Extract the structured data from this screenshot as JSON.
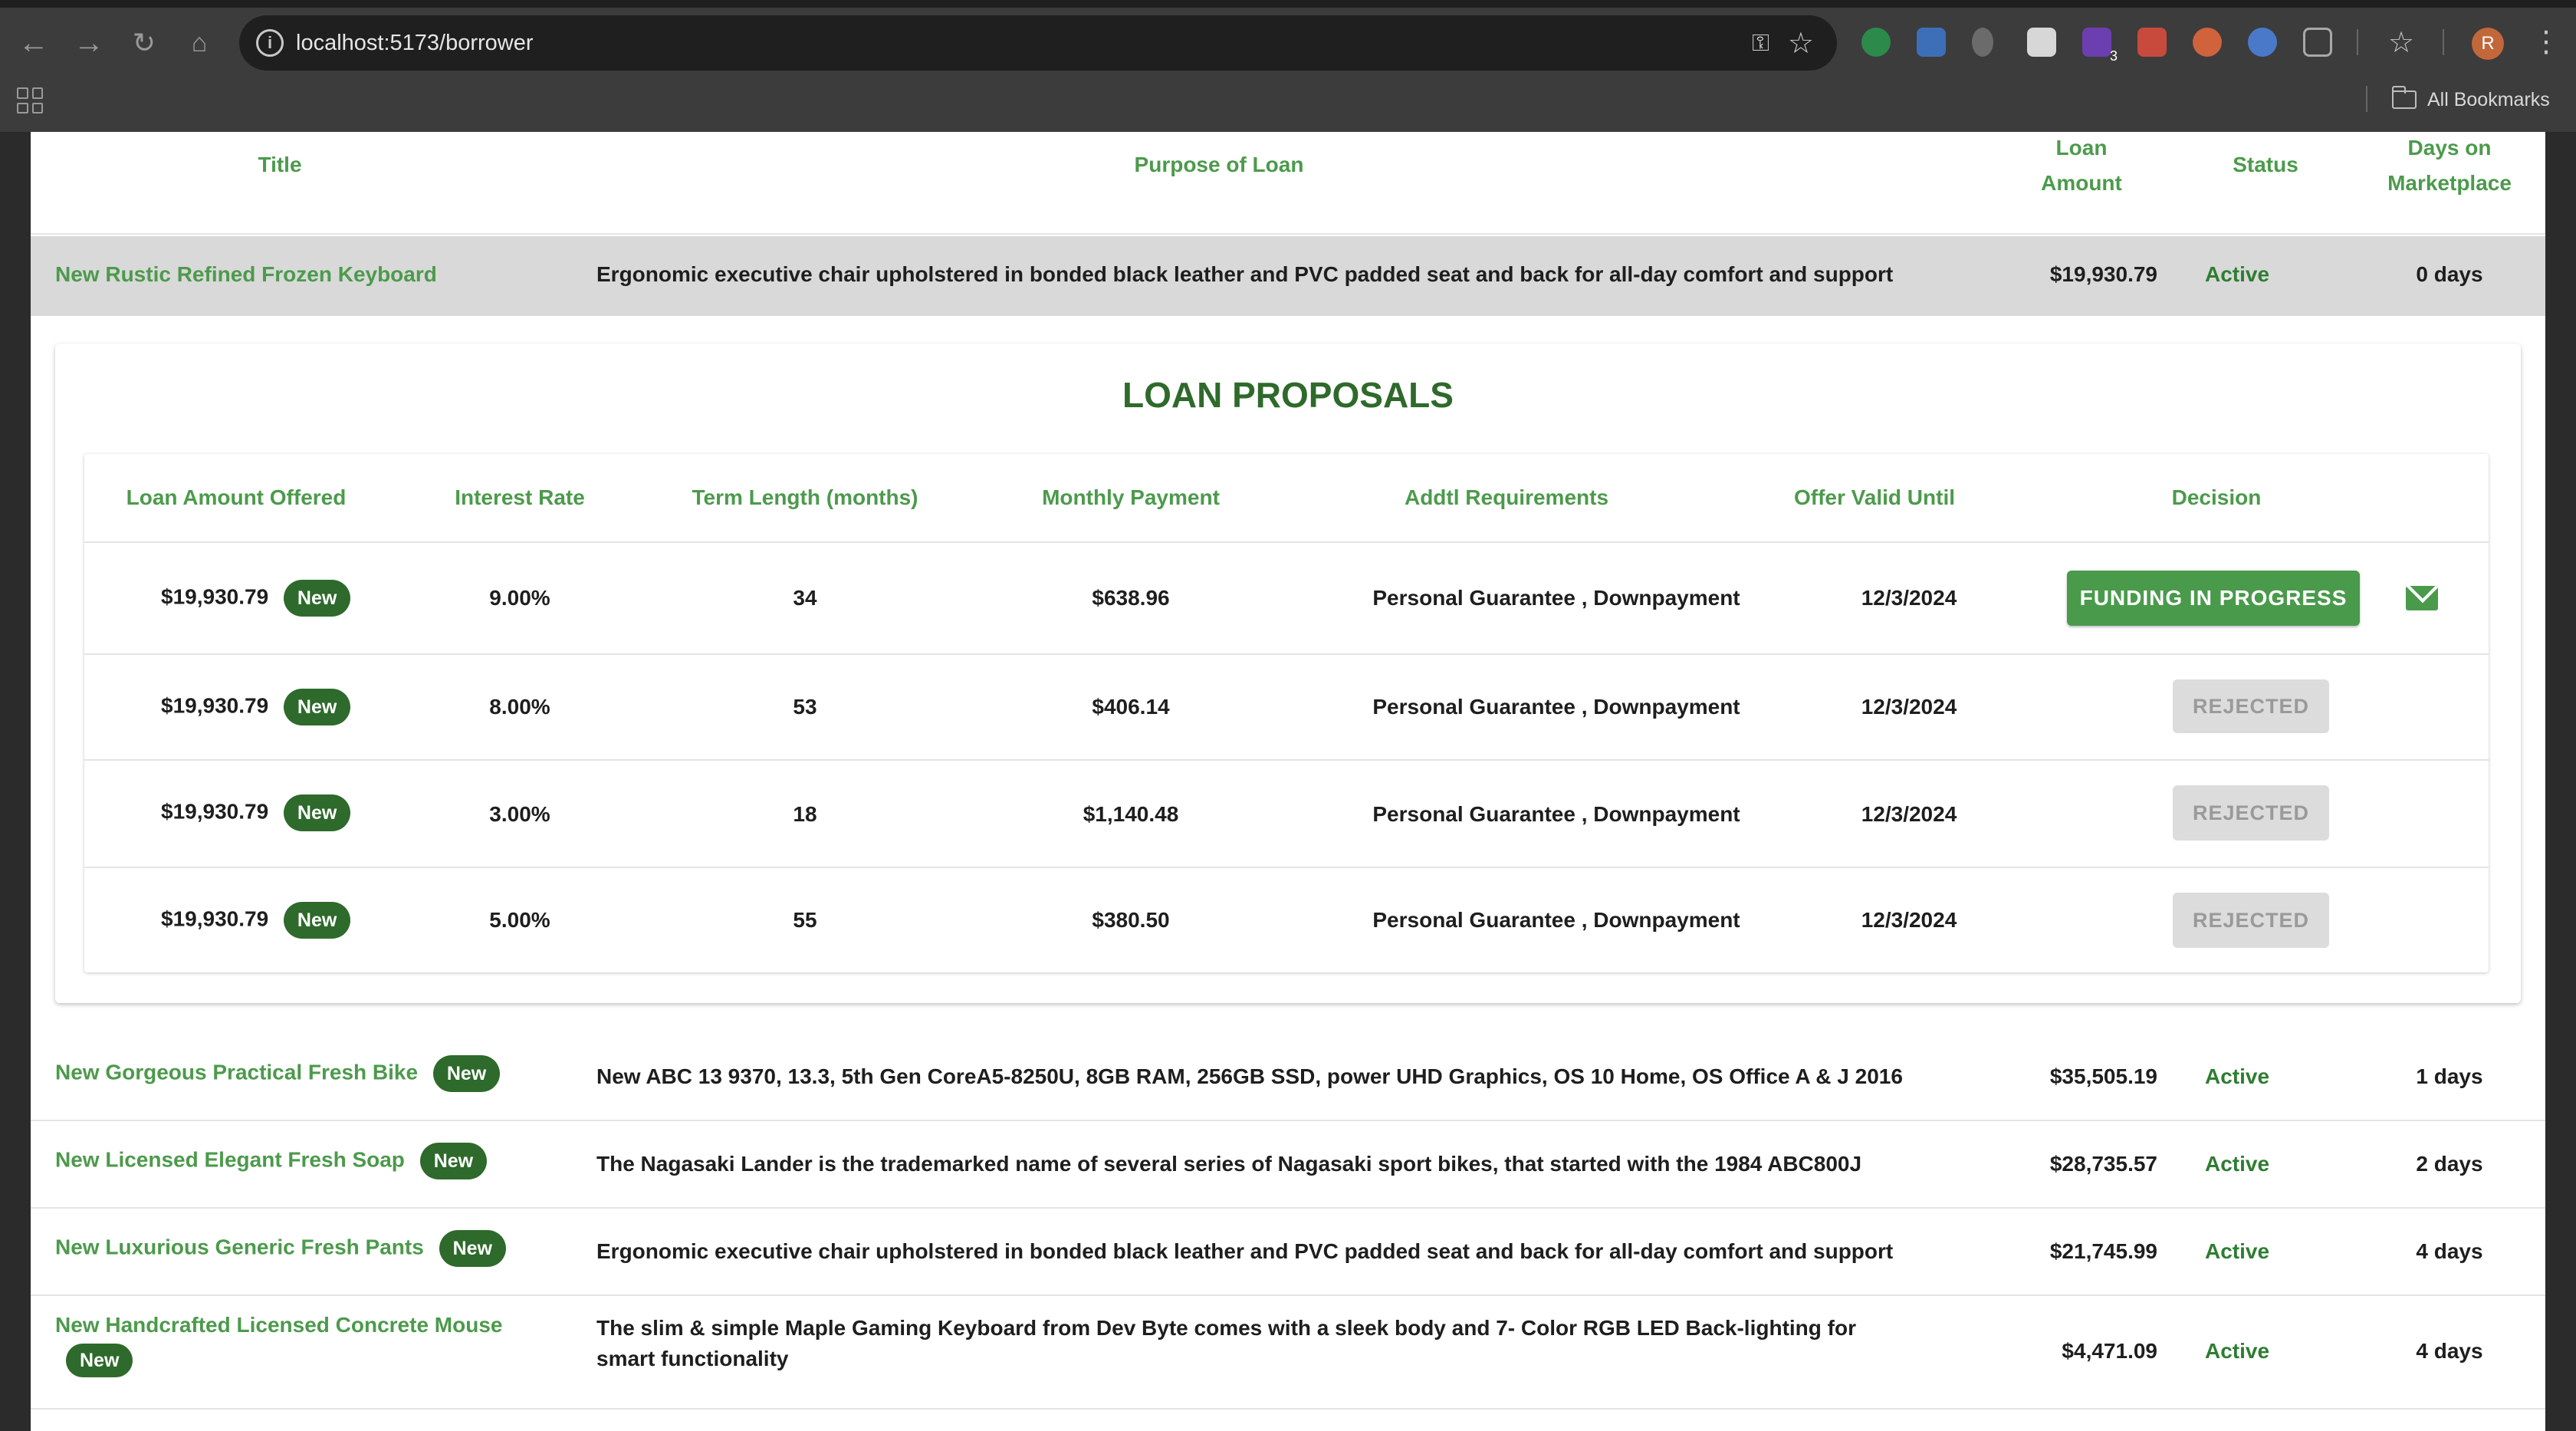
{
  "browser": {
    "url": "localhost:5173/borrower",
    "bookmarks_label": "All Bookmarks",
    "profile_initial": "R",
    "extension_badge": "3"
  },
  "loans_table": {
    "headers": {
      "title": "Title",
      "purpose": "Purpose of Loan",
      "amount_line1": "Loan",
      "amount_line2": "Amount",
      "status": "Status",
      "days_line1": "Days on",
      "days_line2": "Marketplace"
    },
    "expanded_row": {
      "title": "New Rustic Refined Frozen Keyboard",
      "purpose": "Ergonomic executive chair upholstered in bonded black leather and PVC padded seat and back for all-day comfort and support",
      "amount": "$19,930.79",
      "status": "Active",
      "days": "0 days"
    },
    "rows": [
      {
        "title": "New Gorgeous Practical Fresh Bike",
        "badge": "New",
        "purpose": "New ABC 13 9370, 13.3, 5th Gen CoreA5-8250U, 8GB RAM, 256GB SSD, power UHD Graphics, OS 10 Home, OS Office A & J 2016",
        "amount": "$35,505.19",
        "status": "Active",
        "days": "1 days"
      },
      {
        "title": "New Licensed Elegant Fresh Soap",
        "badge": "New",
        "purpose": "The Nagasaki Lander is the trademarked name of several series of Nagasaki sport bikes, that started with the 1984 ABC800J",
        "amount": "$28,735.57",
        "status": "Active",
        "days": "2 days"
      },
      {
        "title": "New Luxurious Generic Fresh Pants",
        "badge": "New",
        "purpose": "Ergonomic executive chair upholstered in bonded black leather and PVC padded seat and back for all-day comfort and support",
        "amount": "$21,745.99",
        "status": "Active",
        "days": "4 days"
      },
      {
        "title": "New Handcrafted Licensed Concrete Mouse",
        "badge": "New",
        "purpose": "The slim & simple Maple Gaming Keyboard from Dev Byte comes with a sleek body and 7- Color RGB LED Back-lighting for smart functionality",
        "amount": "$4,471.09",
        "status": "Active",
        "days": "4 days"
      }
    ]
  },
  "proposals": {
    "title": "LOAN PROPOSALS",
    "headers": {
      "amount": "Loan Amount Offered",
      "rate": "Interest Rate",
      "term": "Term Length (months)",
      "payment": "Monthly Payment",
      "requirements": "Addtl Requirements",
      "valid": "Offer Valid Until",
      "decision": "Decision"
    },
    "rows": [
      {
        "amount": "$19,930.79",
        "badge": "New",
        "rate": "9.00%",
        "term": "34",
        "payment": "$638.96",
        "requirements": "Personal Guarantee , Downpayment",
        "valid": "12/3/2024",
        "decision": "FUNDING IN PROGRESS"
      },
      {
        "amount": "$19,930.79",
        "badge": "New",
        "rate": "8.00%",
        "term": "53",
        "payment": "$406.14",
        "requirements": "Personal Guarantee , Downpayment",
        "valid": "12/3/2024",
        "decision": "REJECTED"
      },
      {
        "amount": "$19,930.79",
        "badge": "New",
        "rate": "3.00%",
        "term": "18",
        "payment": "$1,140.48",
        "requirements": "Personal Guarantee , Downpayment",
        "valid": "12/3/2024",
        "decision": "REJECTED"
      },
      {
        "amount": "$19,930.79",
        "badge": "New",
        "rate": "5.00%",
        "term": "55",
        "payment": "$380.50",
        "requirements": "Personal Guarantee , Downpayment",
        "valid": "12/3/2024",
        "decision": "REJECTED"
      }
    ]
  },
  "colors": {
    "accent_green": "#4c9a4c",
    "dark_green": "#2e6a2b",
    "status_green": "#2e7d32",
    "expanded_row_bg": "#d9d9d9",
    "rejected_bg": "#dcdcdc"
  },
  "icons": {
    "back": "arrow-left-icon",
    "forward": "arrow-right-icon",
    "reload": "reload-icon",
    "home": "home-icon",
    "site_info": "info-icon",
    "password": "key-icon",
    "bookmark_star": "star-icon",
    "apps": "apps-grid-icon",
    "bookmarks_folder": "folder-icon",
    "email": "mail-icon"
  }
}
